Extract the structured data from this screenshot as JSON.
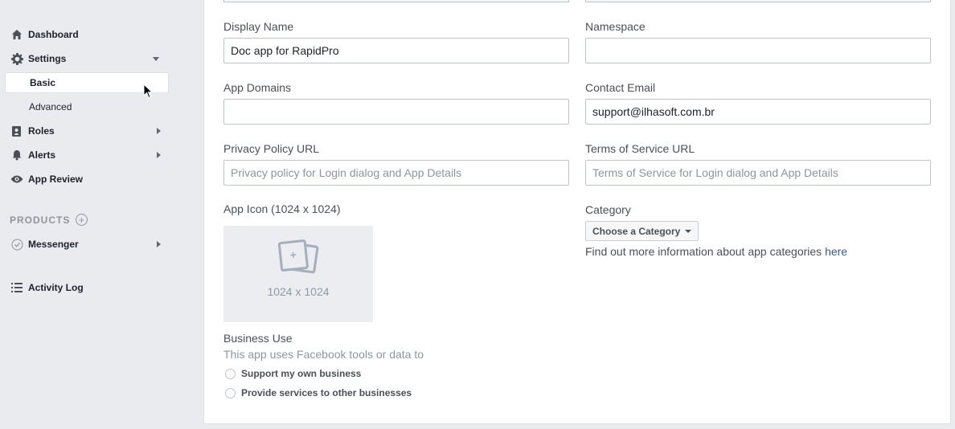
{
  "sidebar": {
    "dashboard": "Dashboard",
    "settings": "Settings",
    "basic": "Basic",
    "advanced": "Advanced",
    "roles": "Roles",
    "alerts": "Alerts",
    "app_review": "App Review",
    "products_header": "PRODUCTS",
    "messenger": "Messenger",
    "activity_log": "Activity Log"
  },
  "form": {
    "display_name": {
      "label": "Display Name",
      "value": "Doc app for RapidPro"
    },
    "namespace": {
      "label": "Namespace",
      "value": ""
    },
    "app_domains": {
      "label": "App Domains",
      "value": ""
    },
    "contact_email": {
      "label": "Contact Email",
      "value": "support@ilhasoft.com.br"
    },
    "privacy_policy": {
      "label": "Privacy Policy URL",
      "placeholder": "Privacy policy for Login dialog and App Details"
    },
    "terms_of_service": {
      "label": "Terms of Service URL",
      "placeholder": "Terms of Service for Login dialog and App Details"
    },
    "app_icon": {
      "label": "App Icon (1024 x 1024)",
      "size_text": "1024 x 1024"
    },
    "category": {
      "label": "Category",
      "button": "Choose a Category",
      "info_text": "Find out more information about app categories ",
      "info_link": "here"
    },
    "business_use": {
      "label": "Business Use",
      "description": "This app uses Facebook tools or data to",
      "options": [
        "Support my own business",
        "Provide services to other businesses"
      ]
    }
  },
  "colors": {
    "background": "#e9ebee",
    "link": "#365899",
    "panel": "#ffffff"
  }
}
